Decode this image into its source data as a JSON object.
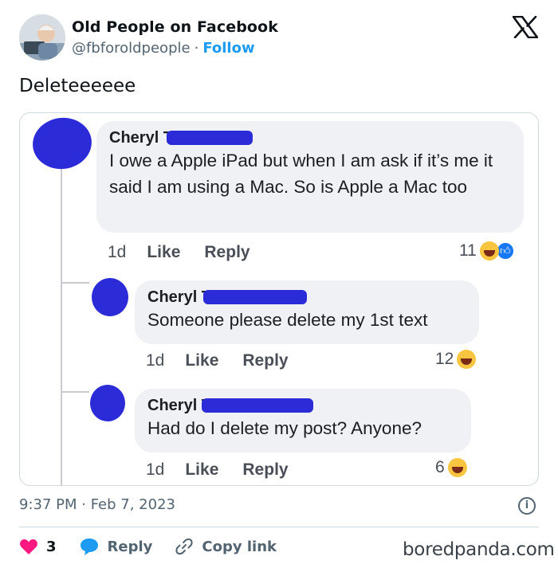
{
  "tweet": {
    "author_name": "Old People on Facebook",
    "handle": "@fbforoldpeople",
    "separator": "·",
    "follow_label": "Follow",
    "text": "Deleteeeeee",
    "timestamp": "9:37 PM · Feb 7, 2023",
    "likes": "3",
    "reply_label": "Reply",
    "copy_link_label": "Copy link",
    "icons": {
      "x_logo": "x-logo-icon",
      "info": "info-icon",
      "like": "heart-icon",
      "reply": "speech-bubble-icon",
      "copy_link": "link-icon"
    },
    "colors": {
      "follow": "#1d9bf0",
      "heart": "#f91880",
      "reply": "#1d9bf0"
    }
  },
  "comments": [
    {
      "name": "Cheryl T",
      "text": "I owe a Apple iPad but when I am ask if it’s me it said I am using a  Mac. So is Apple a Mac too",
      "time": "1d",
      "like_label": "Like",
      "reply_label": "Reply",
      "reaction_count": "11"
    },
    {
      "name": "Cheryl T",
      "text": "Someone please delete my 1st text",
      "time": "1d",
      "like_label": "Like",
      "reply_label": "Reply",
      "reaction_count": "12"
    },
    {
      "name": "Cheryl T",
      "text": "Had do I delete my post? Anyone?",
      "time": "1d",
      "like_label": "Like",
      "reply_label": "Reply",
      "reaction_count": "6"
    }
  ],
  "watermark": "boredpanda.com"
}
